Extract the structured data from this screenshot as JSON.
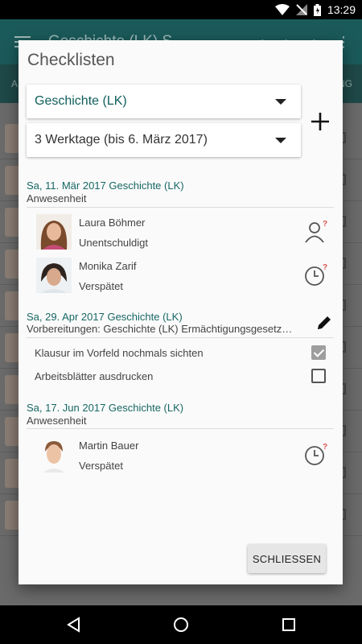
{
  "status_bar": {
    "time": "13:29"
  },
  "background": {
    "toolbar_title": "Geschichte (LK) S…",
    "tab_left": "A",
    "tab_right": "NG"
  },
  "dialog": {
    "title": "Checklisten",
    "subject_spinner": {
      "value": "Geschichte (LK)"
    },
    "range_spinner": {
      "value": "3 Werktage (bis 6. März 2017)"
    },
    "sections": [
      {
        "head": "Sa, 11. Mär 2017 Geschichte (LK)",
        "sub": "Anwesenheit",
        "people": [
          {
            "name": "Laura Böhmer",
            "status": "Unentschuldigt",
            "icon": "person-question-icon"
          },
          {
            "name": "Monika Zarif",
            "status": "Verspätet",
            "icon": "clock-question-icon"
          }
        ]
      },
      {
        "head": "Sa, 29. Apr 2017 Geschichte (LK)",
        "sub": "Vorbereitungen: Geschichte (LK) Ermächtigungsgesetz…",
        "tasks": [
          {
            "label": "Klausur im Vorfeld nochmals sichten",
            "checked": true
          },
          {
            "label": "Arbeitsblätter ausdrucken",
            "checked": false
          }
        ]
      },
      {
        "head": "Sa, 17. Jun 2017 Geschichte (LK)",
        "sub": "Anwesenheit",
        "people": [
          {
            "name": "Martin Bauer",
            "status": "Verspätet",
            "icon": "clock-question-icon"
          }
        ]
      }
    ],
    "close_label": "SCHLIESSEN"
  },
  "colors": {
    "accent": "#176764",
    "toolbar": "#1b5a5a",
    "badge": "#d9534f"
  }
}
